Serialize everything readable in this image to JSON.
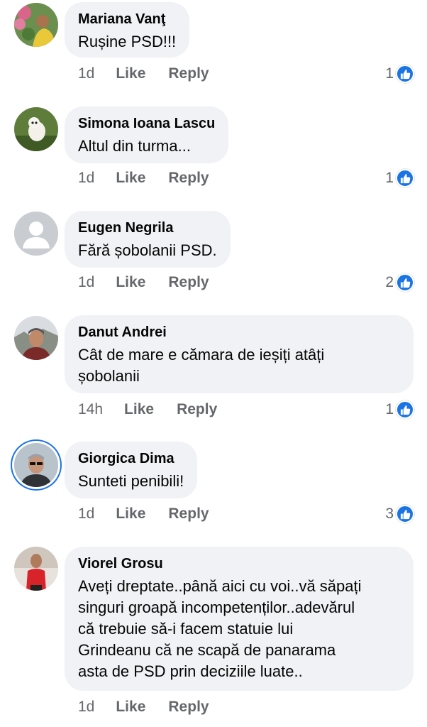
{
  "comments": [
    {
      "author": "Mariana Vanţ",
      "text": "Rușine PSD!!!",
      "time": "1d",
      "like": "Like",
      "reply": "Reply",
      "likes": "1"
    },
    {
      "author": "Simona Ioana Lascu",
      "text": "Altul din turma...",
      "time": "1d",
      "like": "Like",
      "reply": "Reply",
      "likes": "1"
    },
    {
      "author": "Eugen Negrila",
      "text": "Fără șobolanii PSD.",
      "time": "1d",
      "like": "Like",
      "reply": "Reply",
      "likes": "2"
    },
    {
      "author": "Danut Andrei",
      "text_lines": [
        "Cât de mare e cămara de ieșiți atâți",
        "șobolanii"
      ],
      "time": "14h",
      "like": "Like",
      "reply": "Reply",
      "likes": "1"
    },
    {
      "author": "Giorgica Dima",
      "text": "Sunteti penibili!",
      "time": "1d",
      "like": "Like",
      "reply": "Reply",
      "likes": "3"
    },
    {
      "author": "Viorel Grosu",
      "text_lines": [
        "Aveți dreptate..până aici cu voi..vă săpați",
        "singuri groapă incompetenților..adevărul",
        "că trebuie să-i facem statuie lui",
        "Grindeanu că ne scapă de panarama",
        "asta de PSD prin deciziile luate.."
      ],
      "time": "1d",
      "like": "Like",
      "reply": "Reply"
    }
  ],
  "icons": {
    "reaction": "like-thumb-icon",
    "default_avatar": "default-profile-icon"
  },
  "colors": {
    "bubble": "#f0f2f5",
    "meta": "#65676b",
    "like_blue": "#1b74e4"
  }
}
